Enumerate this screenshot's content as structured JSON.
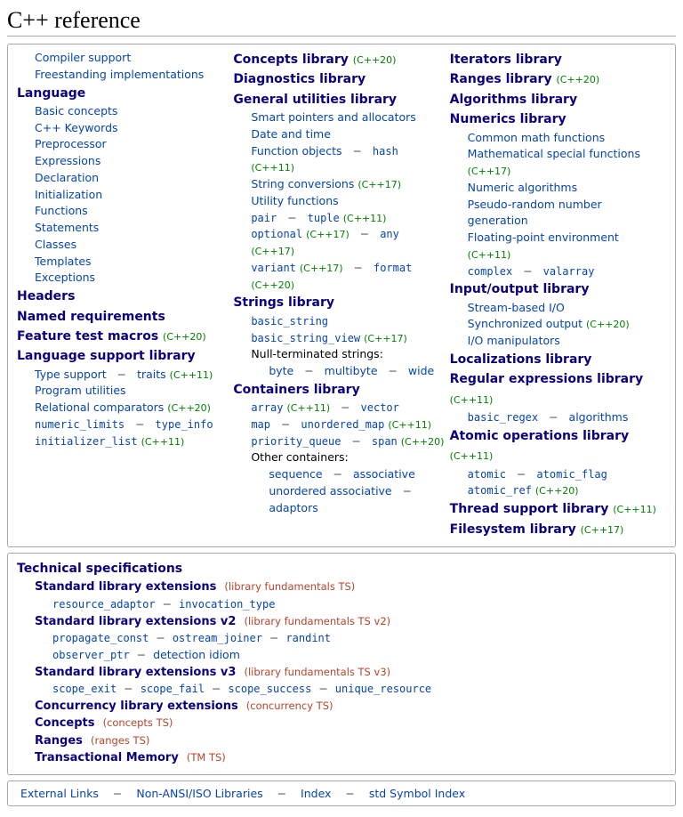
{
  "title": "C++ reference",
  "marks": {
    "cpp11": "(C++11)",
    "cpp17": "(C++17)",
    "cpp20": "(C++20)"
  },
  "sep": "−",
  "col1": {
    "compiler": "Compiler support",
    "freestanding": "Freestanding implementations",
    "language": "Language",
    "basic_concepts": "Basic concepts",
    "keywords": "C++ Keywords",
    "preprocessor": "Preprocessor",
    "expressions": "Expressions",
    "declaration": "Declaration",
    "initialization": "Initialization",
    "functions": "Functions",
    "statements": "Statements",
    "classes": "Classes",
    "templates": "Templates",
    "exceptions": "Exceptions",
    "headers": "Headers",
    "named_req": "Named requirements",
    "feature_test": "Feature test macros",
    "lang_support": "Language support library",
    "type_support": "Type support",
    "traits": "traits",
    "prog_util": "Program utilities",
    "rel_comp": "Relational comparators",
    "numeric_limits": "numeric_limits",
    "type_info": "type_info",
    "initializer_list": "initializer_list"
  },
  "col2": {
    "concepts": "Concepts library",
    "diagnostics": "Diagnostics library",
    "gen_util": "General utilities library",
    "smart_ptr": "Smart pointers and allocators",
    "date_time": "Date and time",
    "func_obj": "Function objects",
    "hash": "hash",
    "str_conv": "String conversions",
    "util_fn": "Utility functions",
    "pair": "pair",
    "tuple": "tuple",
    "optional": "optional",
    "any": "any",
    "variant": "variant",
    "format": "format",
    "strings": "Strings library",
    "basic_string": "basic_string",
    "basic_string_view": "basic_string_view",
    "null_term": "Null-terminated strings:",
    "byte": "byte",
    "multibyte": "multibyte",
    "wide": "wide",
    "containers": "Containers library",
    "array": "array",
    "vector": "vector",
    "map": "map",
    "unordered_map": "unordered_map",
    "priority_queue": "priority_queue",
    "span": "span",
    "other_cont": "Other containers:",
    "sequence": "sequence",
    "associative": "associative",
    "unordered_assoc": "unordered associative",
    "adaptors": "adaptors"
  },
  "col3": {
    "iterators": "Iterators library",
    "ranges": "Ranges library",
    "algorithms": "Algorithms library",
    "numerics": "Numerics library",
    "common_math": "Common math functions",
    "math_special": "Mathematical special functions",
    "num_algo": "Numeric algorithms",
    "prng": "Pseudo-random number generation",
    "fp_env": "Floating-point environment",
    "complex": "complex",
    "valarray": "valarray",
    "io": "Input/output library",
    "stream_io": "Stream-based I/O",
    "sync_out": "Synchronized output",
    "io_manip": "I/O manipulators",
    "localizations": "Localizations library",
    "regex": "Regular expressions library",
    "basic_regex": "basic_regex",
    "re_algo": "algorithms",
    "atomic_ops": "Atomic operations library",
    "atomic": "atomic",
    "atomic_flag": "atomic_flag",
    "atomic_ref": "atomic_ref",
    "thread": "Thread support library",
    "filesystem": "Filesystem library"
  },
  "box2": {
    "tech_spec": "Technical specifications",
    "std_ext": "Standard library extensions",
    "std_ext_ts": "(library fundamentals TS)",
    "resource_adaptor": "resource_adaptor",
    "invocation_type": "invocation_type",
    "std_ext2": "Standard library extensions v2",
    "std_ext2_ts": "(library fundamentals TS v2)",
    "propagate_const": "propagate_const",
    "ostream_joiner": "ostream_joiner",
    "randint": "randint",
    "observer_ptr": "observer_ptr",
    "detection_idiom": "detection idiom",
    "std_ext3": "Standard library extensions v3",
    "std_ext3_ts": "(library fundamentals TS v3)",
    "scope_exit": "scope_exit",
    "scope_fail": "scope_fail",
    "scope_success": "scope_success",
    "unique_resource": "unique_resource",
    "concurrency": "Concurrency library extensions",
    "concurrency_ts": "(concurrency TS)",
    "concepts": "Concepts",
    "concepts_ts": "(concepts TS)",
    "ranges": "Ranges",
    "ranges_ts": "(ranges TS)",
    "tm": "Transactional Memory",
    "tm_ts": "(TM TS)"
  },
  "footer": {
    "external": "External Links",
    "nonansi": "Non-ANSI/ISO Libraries",
    "index": "Index",
    "std_index": "std Symbol Index"
  }
}
